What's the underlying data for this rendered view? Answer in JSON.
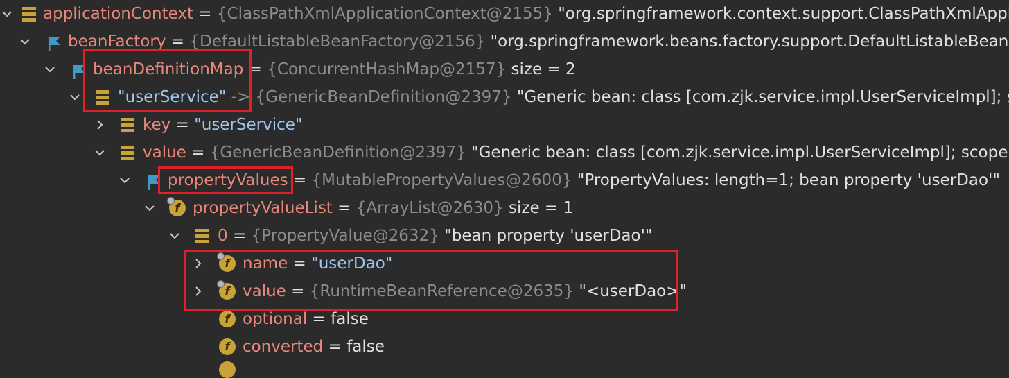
{
  "rows": [
    {
      "name": "applicationContext",
      "eq": "=",
      "type": "{ClassPathXmlApplicationContext@2155}",
      "desc": "\"org.springframework.context.support.ClassPathXmlApplica"
    },
    {
      "name": "beanFactory",
      "eq": "=",
      "type": "{DefaultListableBeanFactory@2156}",
      "desc": "\"org.springframework.beans.factory.support.DefaultListableBeanFac"
    },
    {
      "name": "beanDefinitionMap",
      "eq": "=",
      "type": "{ConcurrentHashMap@2157}",
      "desc": "size = 2"
    },
    {
      "name": "\"userService\"",
      "eq": "->",
      "type": "{GenericBeanDefinition@2397}",
      "desc": "\"Generic bean: class [com.zjk.service.impl.UserServiceImpl]; scop"
    },
    {
      "name": "key",
      "eq": "=",
      "type": "",
      "desc": "\"userService\""
    },
    {
      "name": "value",
      "eq": "=",
      "type": "{GenericBeanDefinition@2397}",
      "desc": "\"Generic bean: class [com.zjk.service.impl.UserServiceImpl]; scope=; ab"
    },
    {
      "name": "propertyValues",
      "eq": "=",
      "type": "{MutablePropertyValues@2600}",
      "desc": "\"PropertyValues: length=1; bean property 'userDao'\""
    },
    {
      "name": "propertyValueList",
      "eq": "=",
      "type": "{ArrayList@2630}",
      "desc": "size = 1"
    },
    {
      "name": "0",
      "eq": "=",
      "type": "{PropertyValue@2632}",
      "desc": "\"bean property 'userDao'\""
    },
    {
      "name": "name",
      "eq": "=",
      "type": "",
      "desc": "\"userDao\""
    },
    {
      "name": "value",
      "eq": "=",
      "type": "{RuntimeBeanReference@2635}",
      "desc": "\"<userDao>\""
    },
    {
      "name": "optional",
      "eq": "=",
      "type": "",
      "desc": "false"
    },
    {
      "name": "converted",
      "eq": "=",
      "type": "",
      "desc": "false"
    }
  ]
}
